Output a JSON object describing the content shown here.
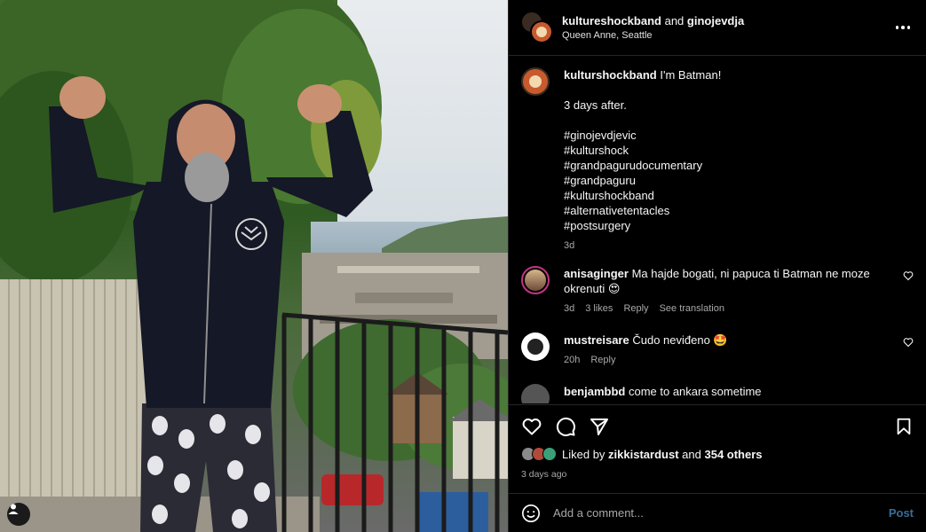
{
  "header": {
    "author": "kultureshockband",
    "and_text": "and",
    "coauthor": "ginojevdja",
    "location": "Queen Anne, Seattle"
  },
  "post": {
    "author": "kulturshockband",
    "caption_first": "I'm Batman!",
    "caption_second": "3 days after.",
    "hashtags": [
      "#ginojevdjevic",
      "#kulturshock",
      "#grandpagurudocumentary",
      "#grandpaguru",
      "#kulturshockband",
      "#alternativetentacles",
      "#postsurgery"
    ],
    "time": "3d"
  },
  "comments": [
    {
      "user": "anisaginger",
      "text": "Ma hajde bogati, ni papuca ti Batman ne moze okrenuti 😍",
      "time": "3d",
      "likes": "3 likes",
      "reply": "Reply",
      "translate": "See translation"
    },
    {
      "user": "mustreisare",
      "text": "Čudo neviđeno 🤩",
      "time": "20h",
      "reply": "Reply"
    },
    {
      "user": "benjambbd",
      "text": "come to ankara sometime"
    }
  ],
  "likes": {
    "prefix": "Liked by",
    "user": "zikkistardust",
    "and_text": "and",
    "others": "354 others"
  },
  "timestamp": "3 days ago",
  "add_comment": {
    "placeholder": "Add a comment...",
    "post_label": "Post"
  },
  "colors": {
    "background": "#000000",
    "border": "#262626",
    "muted_text": "#a8a8a8",
    "post_button": "#3a6d99",
    "story_ring": "#c13584"
  },
  "icons": [
    "more-options-icon",
    "heart-icon",
    "comment-icon",
    "share-icon",
    "bookmark-icon",
    "emoji-icon",
    "user-tag-icon"
  ]
}
